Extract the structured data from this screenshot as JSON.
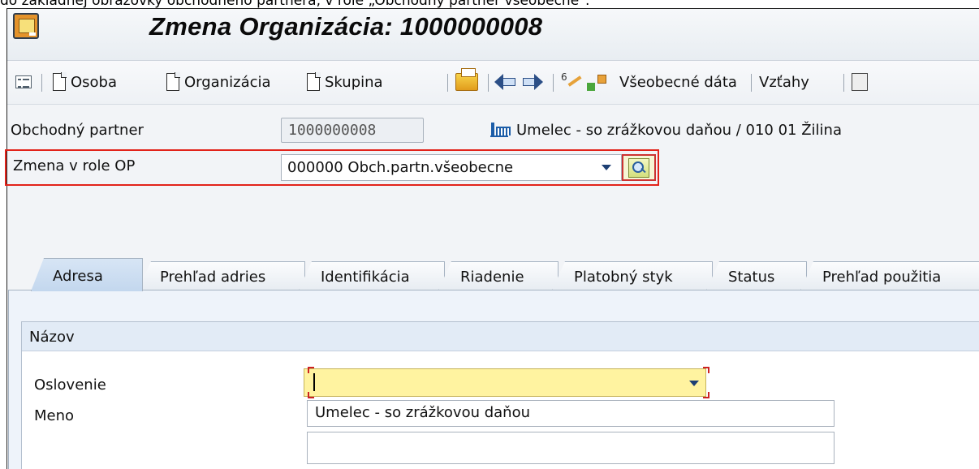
{
  "caption": "do základnej obrazovky obchodného partnera, v role „Obchodný partner všeobecne\".",
  "window": {
    "title": "Zmena Organizácia: 1000000008"
  },
  "toolbar": {
    "osoba": "Osoba",
    "organizacia": "Organizácia",
    "skupina": "Skupina",
    "vseobecne_data": "Všeobecné dáta",
    "vztahy": "Vzťahy"
  },
  "header": {
    "bp_label": "Obchodný partner",
    "bp_number": "1000000008",
    "bp_description": "Umelec - so zrážkovou daňou / 010 01 Žilina",
    "role_label": "Zmena v role OP",
    "role_value": "000000 Obch.partn.všeobecne"
  },
  "tabs": [
    {
      "label": "Adresa",
      "active": true
    },
    {
      "label": "Prehľad adries"
    },
    {
      "label": "Identifikácia"
    },
    {
      "label": "Riadenie"
    },
    {
      "label": "Platobný styk"
    },
    {
      "label": "Status"
    },
    {
      "label": "Prehľad použitia"
    }
  ],
  "address": {
    "group_title": "Názov",
    "salutation_label": "Oslovenie",
    "salutation_value": "",
    "name_label": "Meno",
    "name_value": "Umelec - so zrážkovou daňou",
    "name2_value": ""
  },
  "icons": {
    "app": "sap-app-icon",
    "list": "list-view-icon",
    "page": "new-document-icon",
    "folder": "open-folder-icon",
    "back": "arrow-left-icon",
    "forward": "arrow-right-icon",
    "where_used": "glasses-icon",
    "roles": "roles-icon",
    "org": "organization-icon",
    "role_switch": "switch-role-icon"
  },
  "colors": {
    "highlight_border": "#e2231a",
    "required_field": "#fff3a0",
    "active_tab": "#c3d7ee",
    "group_header": "#e2ebf6"
  }
}
